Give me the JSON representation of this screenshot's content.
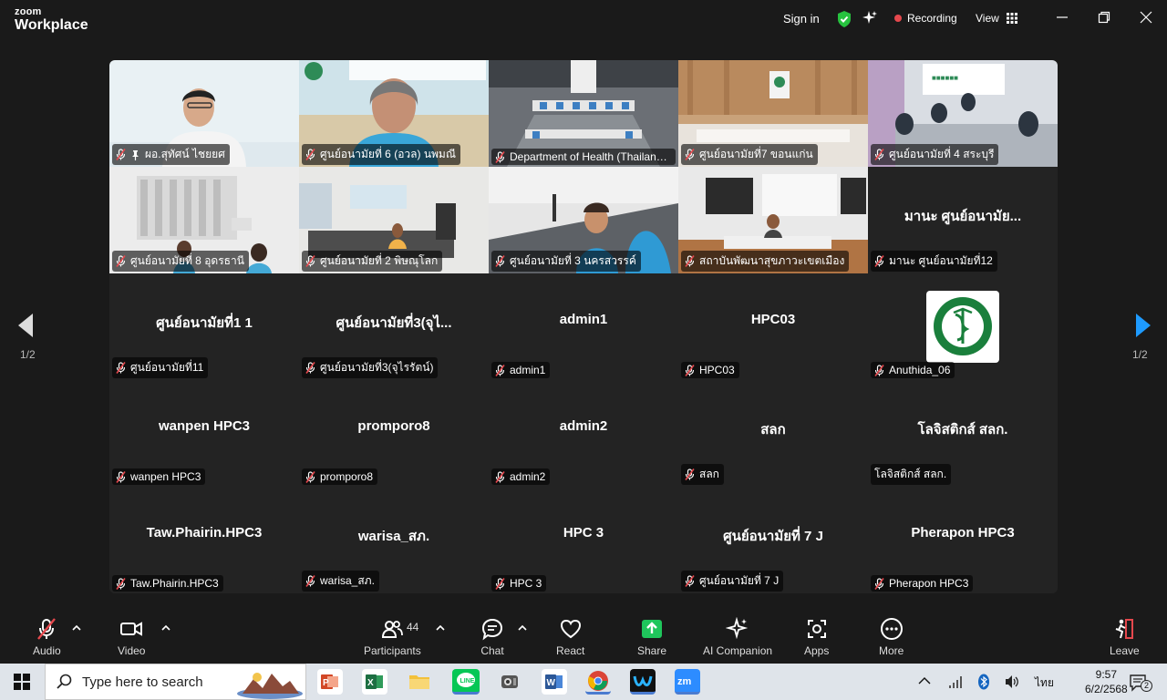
{
  "app": {
    "brand_top": "zoom",
    "brand_bottom": "Workplace"
  },
  "titlebar": {
    "sign_in": "Sign in",
    "recording": "Recording",
    "view": "View"
  },
  "gallery": {
    "page_label_left": "1/2",
    "page_label_right": "1/2",
    "tiles": [
      {
        "display": "",
        "tag": "ผอ.สุทัศน์ ไชยยศ",
        "pinned": true
      },
      {
        "display": "",
        "tag": "ศูนย์อนามัยที่ 6 (อวล) นพมณี"
      },
      {
        "display": "",
        "tag": "Department of Health (Thailand) ...",
        "active": true
      },
      {
        "display": "",
        "tag": "ศูนย์อนามัยที่7 ขอนแก่น"
      },
      {
        "display": "",
        "tag": "ศูนย์อนามัยที่ 4 สระบุรี"
      },
      {
        "display": "",
        "tag": "ศูนย์อนามัยที่ 8 อุดรธานี"
      },
      {
        "display": "",
        "tag": "ศูนย์อนามัยที่ 2 พิษณุโลก"
      },
      {
        "display": "",
        "tag": "ศูนย์อนามัยที่ 3 นครสวรรค์"
      },
      {
        "display": "",
        "tag": "สถาบันพัฒนาสุขภาวะเขตเมือง"
      },
      {
        "display": "มานะ ศูนย์อนามัย...",
        "tag": "มานะ ศูนย์อนามัยที่12"
      },
      {
        "display": "ศูนย์อนามัยที่1 1",
        "tag": "ศูนย์อนามัยที่11"
      },
      {
        "display": "ศูนย์อนามัยที่3(จุไ...",
        "tag": "ศูนย์อนามัยที่3(จุไรรัตน์)"
      },
      {
        "display": "admin1",
        "tag": "admin1"
      },
      {
        "display": "HPC03",
        "tag": "HPC03"
      },
      {
        "display": "",
        "tag": "Anuthida_06",
        "logo": "MINISTRY OF PUBLIC HEALTH"
      },
      {
        "display": "wanpen HPC3",
        "tag": "wanpen HPC3"
      },
      {
        "display": "promporo8",
        "tag": "promporo8"
      },
      {
        "display": "admin2",
        "tag": "admin2"
      },
      {
        "display": "สลก",
        "tag": "สลก"
      },
      {
        "display": "โลจิสติกส์ สลก.",
        "tag": "โลจิสติกส์ สลก.",
        "no_mic": true
      },
      {
        "display": "Taw.Phairin.HPC3",
        "tag": "Taw.Phairin.HPC3"
      },
      {
        "display": "warisa_สภ.",
        "tag": "warisa_สภ."
      },
      {
        "display": "HPC 3",
        "tag": "HPC 3"
      },
      {
        "display": "ศูนย์อนามัยที่ 7 J",
        "tag": "ศูนย์อนามัยที่ 7 J"
      },
      {
        "display": "Pherapon HPC3",
        "tag": "Pherapon HPC3"
      }
    ]
  },
  "toolbar": {
    "audio": "Audio",
    "video": "Video",
    "participants": "Participants",
    "participants_count": "44",
    "chat": "Chat",
    "react": "React",
    "share": "Share",
    "ai_companion": "AI Companion",
    "apps": "Apps",
    "more": "More",
    "leave": "Leave"
  },
  "taskbar": {
    "search_placeholder": "Type here to search",
    "time": "9:57",
    "date": "6/2/2568",
    "language": "ไทย",
    "notifications": "2"
  }
}
